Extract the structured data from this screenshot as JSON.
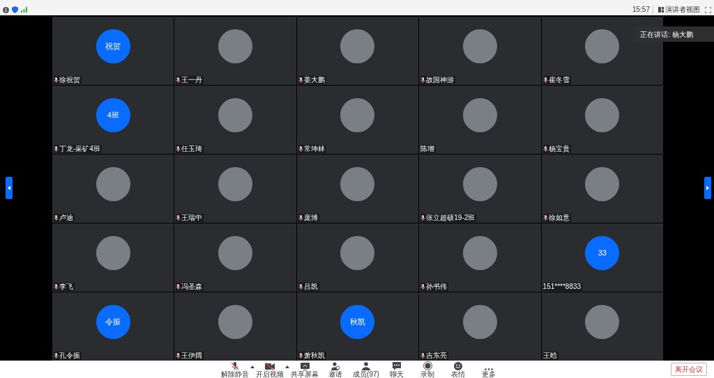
{
  "status_bar": {
    "time": "15:57",
    "view_button": "演讲者视图"
  },
  "speaking": {
    "label": "正在讲话: 杨大鹏"
  },
  "participants": [
    {
      "name": "徐祝贺",
      "muted": true,
      "avatar": {
        "kind": "initials",
        "text": "祝贺"
      }
    },
    {
      "name": "王一丹",
      "muted": true,
      "avatar": {
        "kind": "photo"
      }
    },
    {
      "name": "姜大鹏",
      "muted": true,
      "avatar": {
        "kind": "photo"
      }
    },
    {
      "name": "故国神游",
      "muted": true,
      "avatar": {
        "kind": "photo"
      }
    },
    {
      "name": "崔冬雪",
      "muted": true,
      "avatar": {
        "kind": "photo"
      }
    },
    {
      "name": "丁龙-采矿4班",
      "muted": true,
      "avatar": {
        "kind": "initials",
        "text": "4班"
      }
    },
    {
      "name": "任玉琦",
      "muted": true,
      "avatar": {
        "kind": "photo"
      }
    },
    {
      "name": "常坤林",
      "muted": true,
      "avatar": {
        "kind": "photo"
      }
    },
    {
      "name": "陈增",
      "muted": false,
      "avatar": {
        "kind": "photo"
      }
    },
    {
      "name": "杨宝贵",
      "muted": true,
      "avatar": {
        "kind": "photo"
      }
    },
    {
      "name": "卢迪",
      "muted": true,
      "avatar": {
        "kind": "photo"
      }
    },
    {
      "name": "王瑞中",
      "muted": true,
      "avatar": {
        "kind": "photo"
      }
    },
    {
      "name": "庞博",
      "muted": true,
      "avatar": {
        "kind": "photo"
      }
    },
    {
      "name": "张立超硕19-2班",
      "muted": true,
      "avatar": {
        "kind": "photo"
      }
    },
    {
      "name": "徐如意",
      "muted": true,
      "avatar": {
        "kind": "photo"
      }
    },
    {
      "name": "李飞",
      "muted": true,
      "avatar": {
        "kind": "photo"
      }
    },
    {
      "name": "冯圣森",
      "muted": true,
      "avatar": {
        "kind": "photo"
      }
    },
    {
      "name": "吕凯",
      "muted": true,
      "avatar": {
        "kind": "photo"
      }
    },
    {
      "name": "孙书伟",
      "muted": true,
      "avatar": {
        "kind": "photo"
      }
    },
    {
      "name": "151****8833",
      "muted": false,
      "avatar": {
        "kind": "initials",
        "text": "33"
      }
    },
    {
      "name": "孔令振",
      "muted": true,
      "avatar": {
        "kind": "initials",
        "text": "令振"
      }
    },
    {
      "name": "王伊阔",
      "muted": true,
      "avatar": {
        "kind": "photo"
      }
    },
    {
      "name": "萧秋凯",
      "muted": true,
      "avatar": {
        "kind": "initials",
        "text": "秋凯"
      }
    },
    {
      "name": "吉东亮",
      "muted": true,
      "avatar": {
        "kind": "photo"
      }
    },
    {
      "name": "王晗",
      "muted": false,
      "avatar": {
        "kind": "photo"
      }
    }
  ],
  "toolbar": [
    {
      "kind": "mic",
      "label": "解除静音",
      "caret": true
    },
    {
      "kind": "video",
      "label": "开启视频",
      "caret": true
    },
    {
      "kind": "share",
      "label": "共享屏幕",
      "caret": false
    },
    {
      "kind": "invite",
      "label": "邀请",
      "caret": false
    },
    {
      "kind": "members",
      "label": "成员(97)",
      "caret": false
    },
    {
      "kind": "chat",
      "label": "聊天",
      "caret": false
    },
    {
      "kind": "record",
      "label": "录制",
      "caret": false
    },
    {
      "kind": "emoji",
      "label": "表情",
      "caret": false
    },
    {
      "kind": "more",
      "label": "更多",
      "caret": false
    }
  ],
  "leave_button": "离开会议"
}
